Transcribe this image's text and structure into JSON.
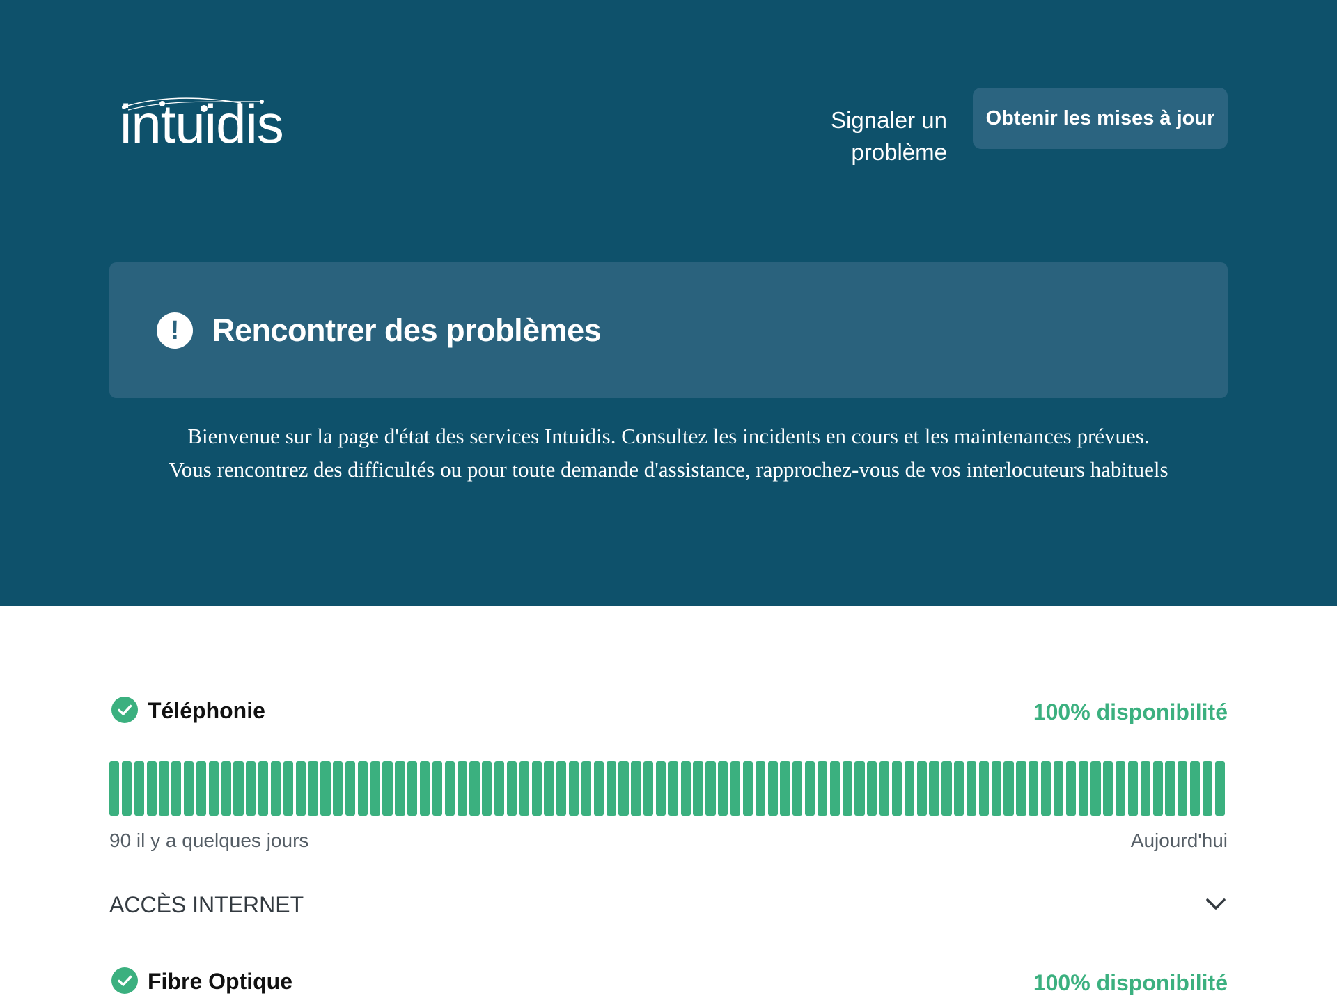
{
  "header": {
    "logo_text": "intuidis",
    "report_link": "Signaler un problème",
    "updates_button": "Obtenir les mises à jour"
  },
  "status": {
    "title": "Rencontrer des problèmes",
    "icon": "exclamation-icon"
  },
  "intro": {
    "line1": "Bienvenue sur la page d'état des services Intuidis. Consultez les incidents en cours et les maintenances prévues.",
    "line2": "Vous rencontrez des difficultés ou pour toute demande d'assistance, rapprochez-vous de vos interlocuteurs habituels"
  },
  "components": [
    {
      "name": "Téléphonie",
      "uptime": "100% disponibilité",
      "status": "operational",
      "days": 90,
      "range_start": "90 il y a quelques jours",
      "range_end": "Aujourd'hui"
    }
  ],
  "groups": [
    {
      "title": "ACCÈS INTERNET",
      "expanded": false
    },
    {
      "child_name": "Fibre Optique",
      "child_uptime": "100% disponibilité"
    }
  ],
  "colors": {
    "hero_bg": "#0e516b",
    "status_box": "#2a627d",
    "operational": "#3bb07f"
  }
}
